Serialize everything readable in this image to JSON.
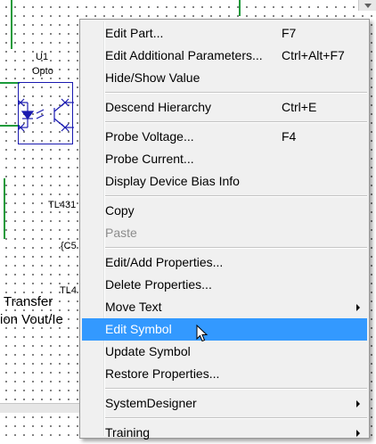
{
  "schematic": {
    "part_ref": "U1",
    "part_value": "Opto",
    "labels": [
      "TL431",
      "{C5",
      "TL4"
    ],
    "text_lines": [
      "Transfer",
      "ion Vout/Ie"
    ]
  },
  "menu": {
    "groups": [
      [
        {
          "label": "Edit Part...",
          "shortcut": "F7"
        },
        {
          "label": "Edit Additional Parameters...",
          "shortcut": "Ctrl+Alt+F7"
        },
        {
          "label": "Hide/Show Value",
          "shortcut": ""
        }
      ],
      [
        {
          "label": "Descend Hierarchy",
          "shortcut": "Ctrl+E"
        }
      ],
      [
        {
          "label": "Probe Voltage...",
          "shortcut": "F4"
        },
        {
          "label": "Probe Current...",
          "shortcut": ""
        },
        {
          "label": "Display Device Bias Info",
          "shortcut": ""
        }
      ],
      [
        {
          "label": "Copy",
          "shortcut": ""
        },
        {
          "label": "Paste",
          "shortcut": "",
          "disabled": true
        }
      ],
      [
        {
          "label": "Edit/Add Properties...",
          "shortcut": ""
        },
        {
          "label": "Delete Properties...",
          "shortcut": ""
        },
        {
          "label": "Move Text",
          "shortcut": "",
          "submenu": true
        },
        {
          "label": "Edit Symbol",
          "shortcut": "",
          "highlighted": true
        },
        {
          "label": "Update Symbol",
          "shortcut": ""
        },
        {
          "label": "Restore Properties...",
          "shortcut": ""
        }
      ],
      [
        {
          "label": "SystemDesigner",
          "shortcut": "",
          "submenu": true
        }
      ],
      [
        {
          "label": "Training",
          "shortcut": "",
          "submenu": true
        }
      ]
    ]
  },
  "colors": {
    "highlight": "#3399ff",
    "wire": "#1a9a3a",
    "symbol": "#1a1ab0"
  }
}
